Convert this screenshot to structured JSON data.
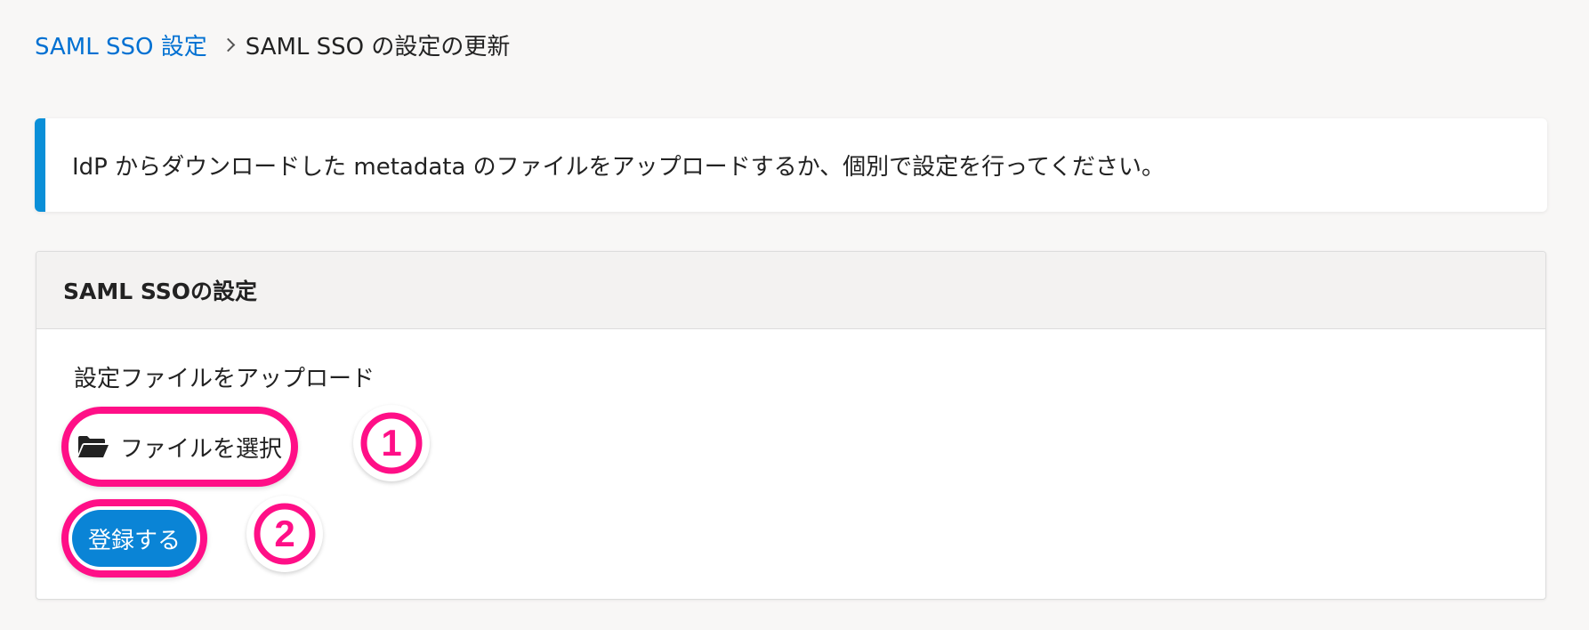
{
  "breadcrumb": {
    "parent": "SAML SSO 設定",
    "current": "SAML SSO の設定の更新"
  },
  "info": {
    "message": "IdP からダウンロードした metadata のファイルをアップロードするか、個別で設定を行ってください。"
  },
  "card": {
    "title": "SAML SSOの設定",
    "upload_label": "設定ファイルをアップロード",
    "file_button_label": "ファイルを選択",
    "submit_button_label": "登録する"
  },
  "annotations": {
    "step1": "1",
    "step2": "2"
  },
  "colors": {
    "accent": "#0a8fd8",
    "link": "#0070d2",
    "highlight": "#ff0f87",
    "button": "#0a84d6",
    "background": "#f8f7f6"
  },
  "icons": {
    "breadcrumb_separator": "chevron-right-icon",
    "file_button": "folder-open-icon"
  }
}
